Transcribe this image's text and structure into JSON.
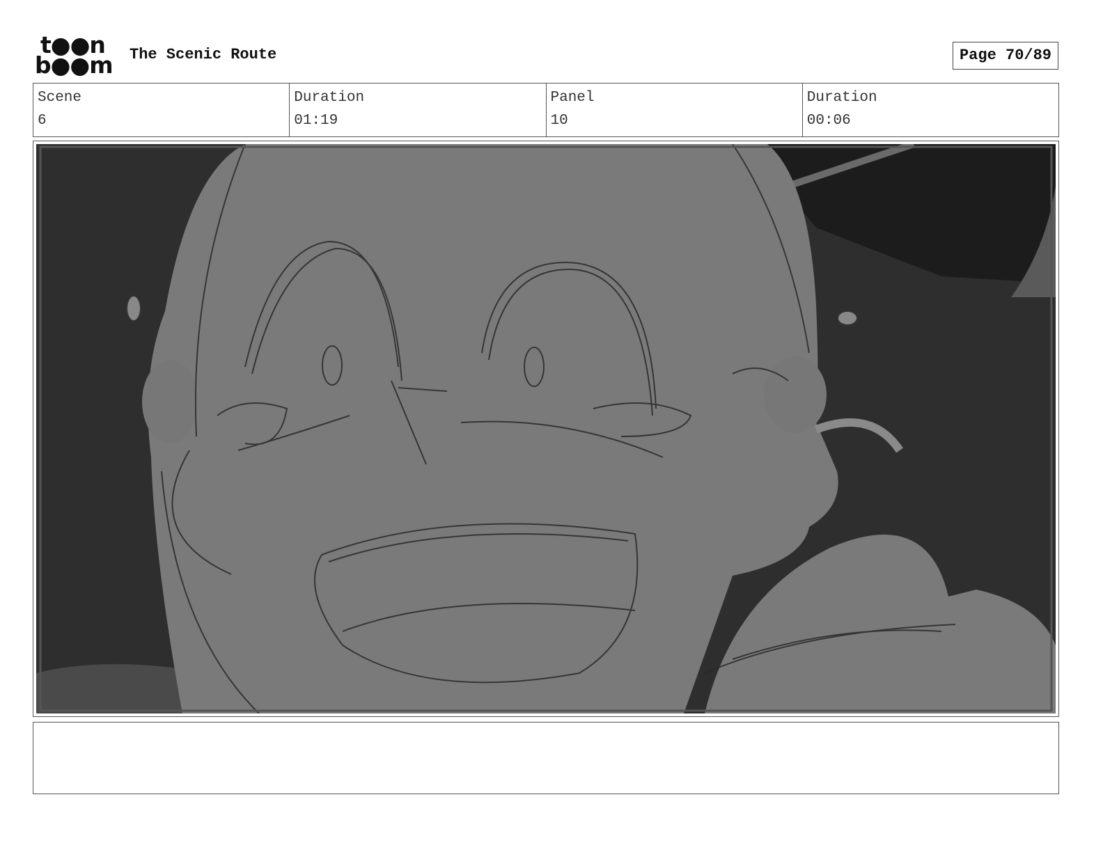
{
  "header": {
    "logo_line1": "t●●n",
    "logo_line2": "b●●m",
    "title": "The Scenic Route",
    "page": "Page 70/89"
  },
  "info": {
    "scene_label": "Scene",
    "scene_value": "6",
    "scene_duration_label": "Duration",
    "scene_duration_value": "01:19",
    "panel_label": "Panel",
    "panel_value": "10",
    "panel_duration_label": "Duration",
    "panel_duration_value": "00:06"
  },
  "panel_image": {
    "icon": "storyboard-sketch-frightened-face"
  },
  "notes": {
    "text": ""
  }
}
